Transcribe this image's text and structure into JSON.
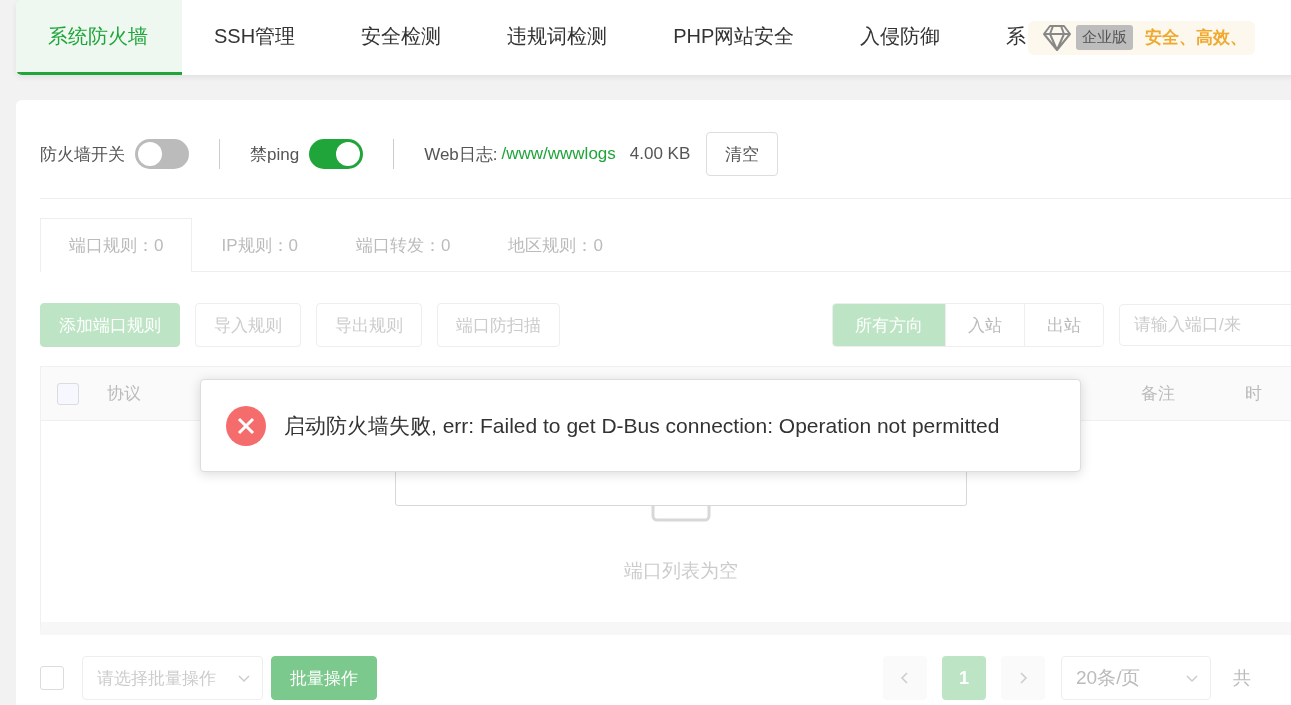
{
  "nav_tabs": [
    {
      "label": "系统防火墙",
      "selected": true
    },
    {
      "label": "SSH管理",
      "selected": false
    },
    {
      "label": "安全检测",
      "selected": false
    },
    {
      "label": "违规词检测",
      "selected": false
    },
    {
      "label": "PHP网站安全",
      "selected": false
    },
    {
      "label": "入侵防御",
      "selected": false
    },
    {
      "label": "系",
      "selected": false
    }
  ],
  "promo": {
    "badge": "企业版",
    "slogan": "安全、高效、"
  },
  "toolbar": {
    "firewall_switch": {
      "label": "防火墙开关",
      "on": false
    },
    "ping_switch": {
      "label": "禁ping",
      "on": true
    },
    "web_log": {
      "label": "Web日志:",
      "path": "/www/wwwlogs",
      "size": "4.00 KB"
    },
    "clear_button": "清空"
  },
  "rule_tabs": [
    {
      "label": "端口规则：0",
      "selected": true
    },
    {
      "label": "IP规则：0",
      "selected": false
    },
    {
      "label": "端口转发：0",
      "selected": false
    },
    {
      "label": "地区规则：0",
      "selected": false
    }
  ],
  "actions": [
    {
      "label": "添加端口规则",
      "kind": "primary"
    },
    {
      "label": "导入规则",
      "kind": "default"
    },
    {
      "label": "导出规则",
      "kind": "default"
    },
    {
      "label": "端口防扫描",
      "kind": "default"
    }
  ],
  "direction_filter": [
    {
      "label": "所有方向",
      "selected": true
    },
    {
      "label": "入站",
      "selected": false
    },
    {
      "label": "出站",
      "selected": false
    }
  ],
  "search": {
    "placeholder": "请输入端口/来"
  },
  "table": {
    "select_all_checked": false,
    "columns": [
      "协议",
      "备注",
      "时"
    ],
    "empty_text": "端口列表为空"
  },
  "footer": {
    "select_all_checked": false,
    "batch_select": {
      "placeholder": "请选择批量操作"
    },
    "batch_button": "批量操作",
    "pages": [
      {
        "label": "1",
        "selected": true
      }
    ],
    "page_size": "20条/页",
    "total": "共"
  },
  "toast": {
    "kind": "error",
    "message": "启动防火墙失败, err: Failed to get D-Bus connection: Operation not permitted"
  }
}
